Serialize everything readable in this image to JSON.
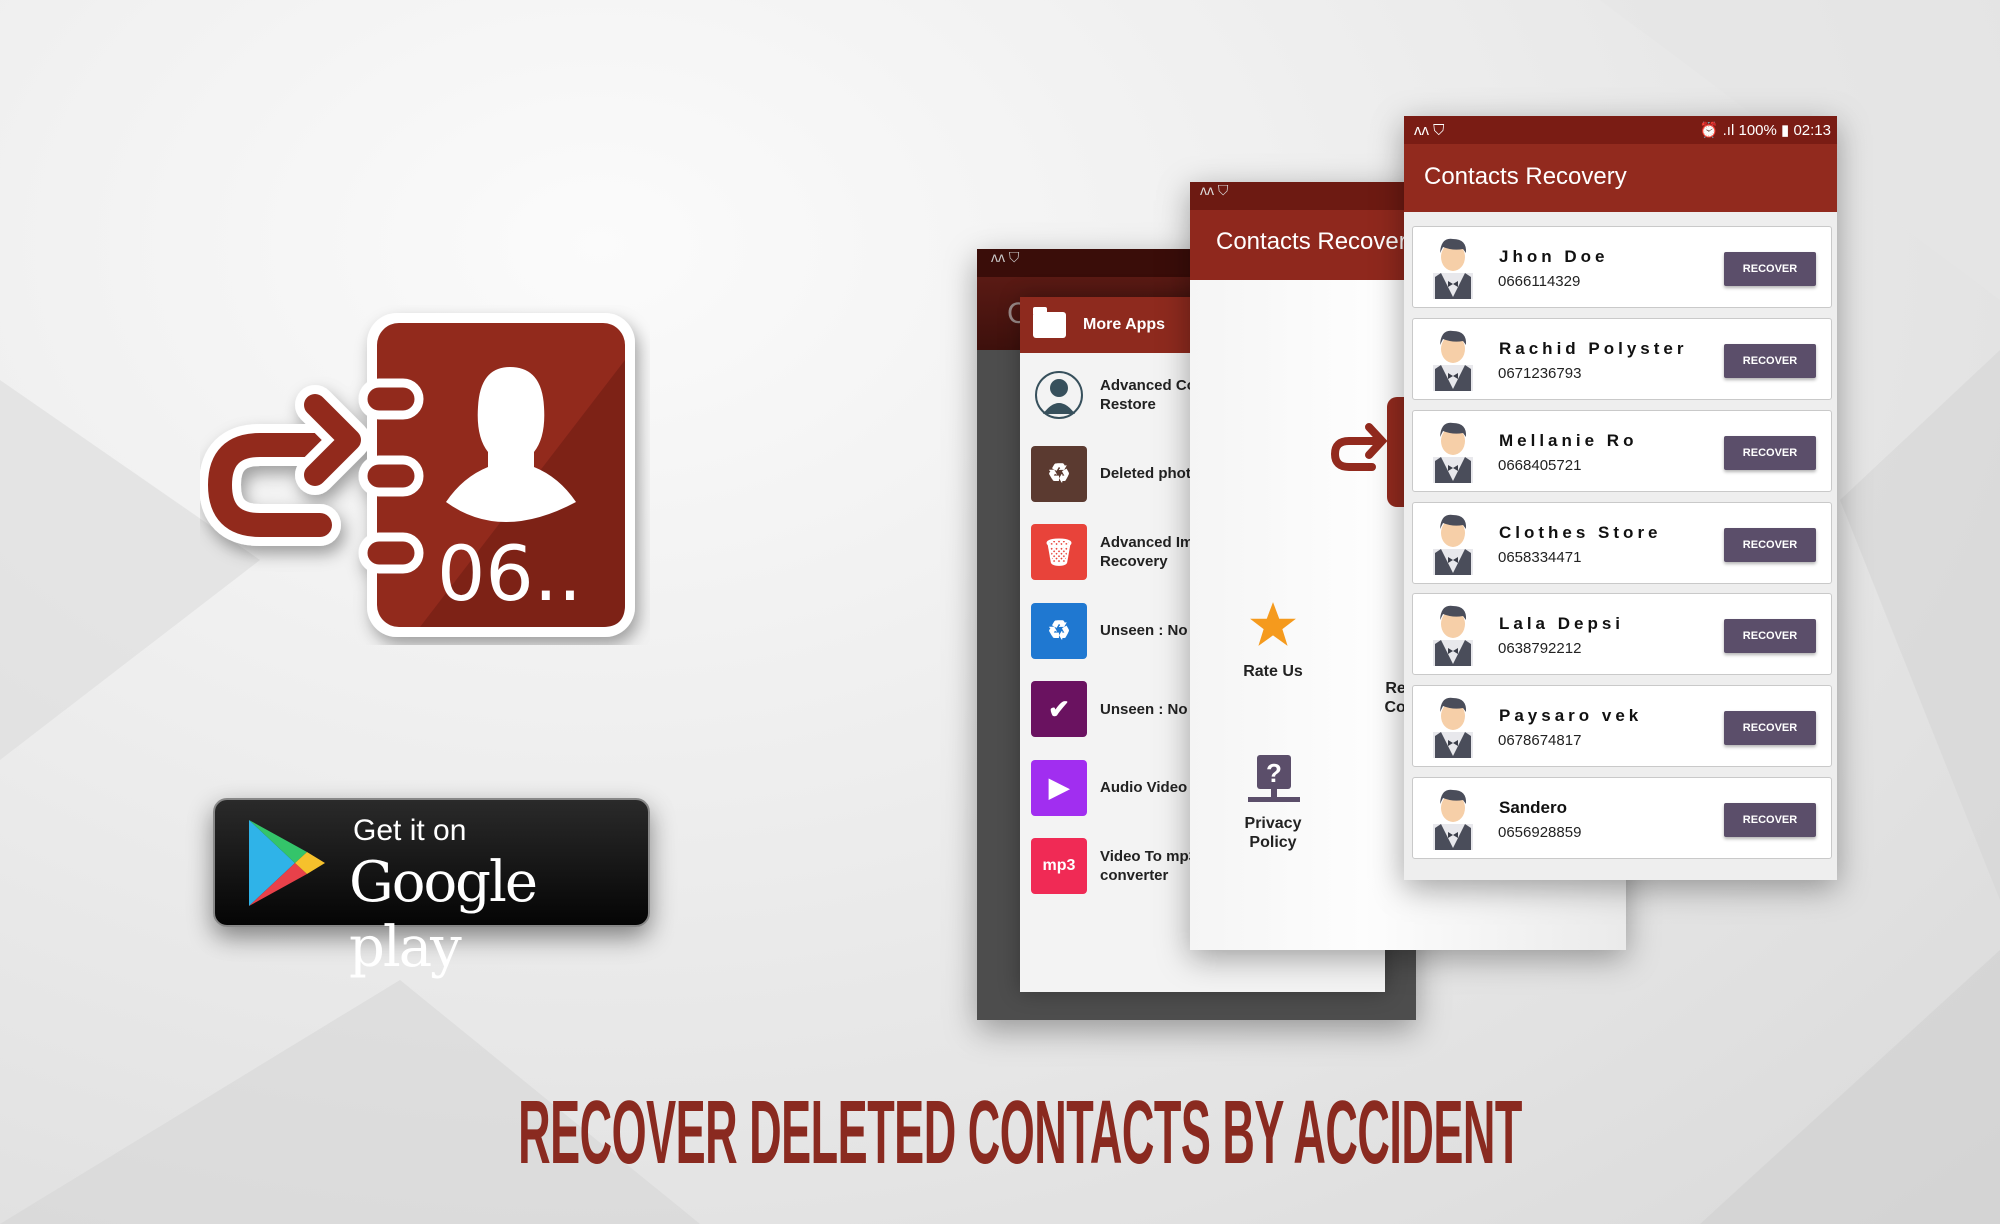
{
  "colors": {
    "brand": "#922a1e",
    "button": "#5b4e6a",
    "headline": "#8a2a20"
  },
  "app_icon": {
    "text": "06.."
  },
  "store_badge": {
    "line1": "Get it on",
    "line2": "Google play"
  },
  "headline": "RECOVER DELETED CONTACTS BY ACCIDENT",
  "back_phone": {
    "title_partial": "C"
  },
  "drawer": {
    "header": "More Apps",
    "items": [
      {
        "label": "Advanced Co\nRestore",
        "icon": "contact-sync-icon",
        "color": "#f3f3f3"
      },
      {
        "label": "Deleted photo",
        "icon": "recycle-bin-icon",
        "color": "#5b3a30"
      },
      {
        "label": "Advanced Im\nRecovery",
        "icon": "trash-can-icon",
        "color": "#e8433a"
      },
      {
        "label": "Unseen : No l",
        "icon": "recycle-bin-icon",
        "color": "#1f78d1"
      },
      {
        "label": "Unseen : No l",
        "icon": "chat-check-icon",
        "color": "#6a1260"
      },
      {
        "label": "Audio Video C",
        "icon": "video-convert-icon",
        "color": "#a12ef0"
      },
      {
        "label": "Video To mp3\nconverter",
        "icon": "mp3-icon",
        "color": "#f02a55"
      }
    ]
  },
  "middle_phone": {
    "title": "Contacts Recovery",
    "rate": "Rate Us",
    "privacy": "Privacy\nPolicy",
    "recover_partial": "Rec\nCon"
  },
  "front_phone": {
    "status": {
      "time": "02:13",
      "battery": "100%"
    },
    "title": "Contacts Recovery",
    "button_label": "RECOVER",
    "contacts": [
      {
        "name": "Jhon Doe",
        "phone": "0666114329"
      },
      {
        "name": "Rachid Polyster",
        "phone": "0671236793"
      },
      {
        "name": "Mellanie Ro",
        "phone": "0668405721"
      },
      {
        "name": "Clothes Store",
        "phone": "0658334471"
      },
      {
        "name": "Lala Depsi",
        "phone": "0638792212"
      },
      {
        "name": "Paysaro vek",
        "phone": "0678674817"
      },
      {
        "name": "Sandero",
        "phone": "0656928859"
      }
    ]
  }
}
